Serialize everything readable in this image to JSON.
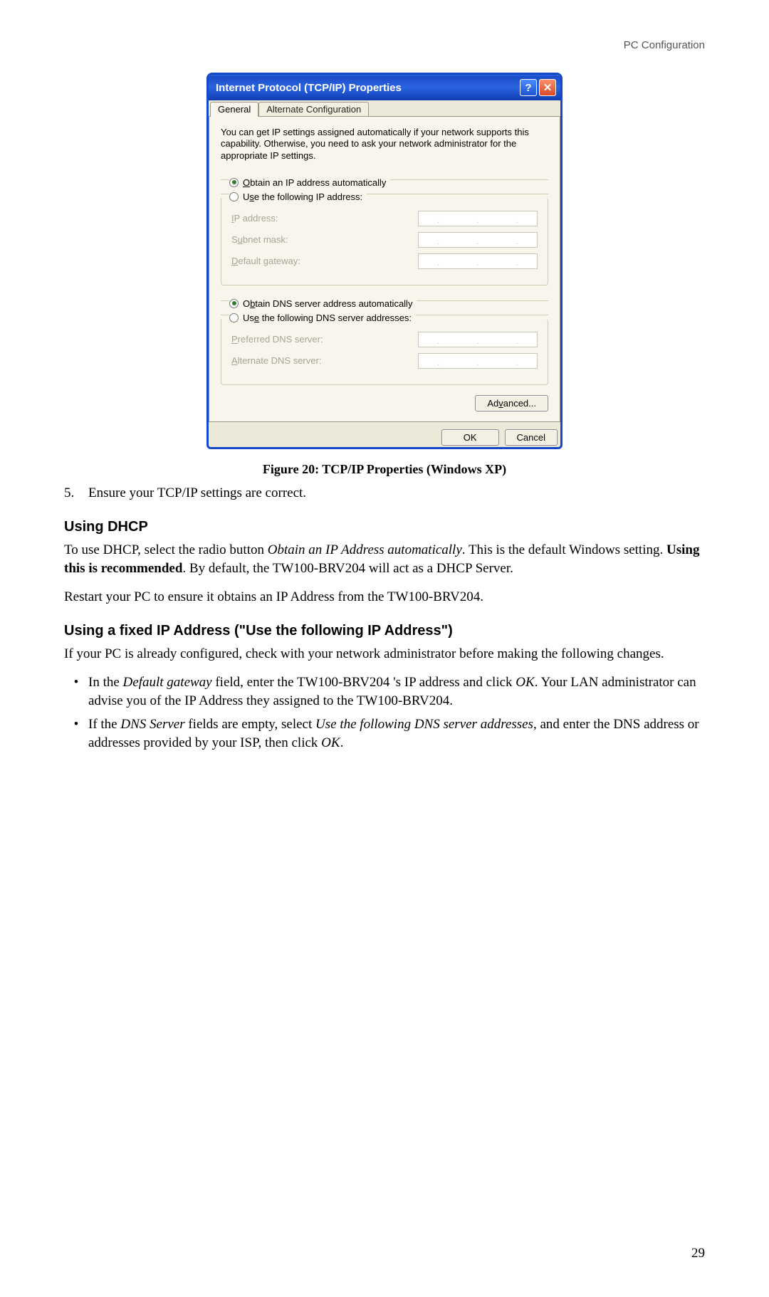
{
  "header": "PC Configuration",
  "page_number": "29",
  "dialog": {
    "title": "Internet Protocol (TCP/IP) Properties",
    "tabs": [
      "General",
      "Alternate Configuration"
    ],
    "description": "You can get IP settings assigned automatically if your network supports this capability. Otherwise, you need to ask your network administrator for the appropriate IP settings.",
    "radio_obtain_ip": "Obtain an IP address automatically",
    "radio_use_ip": "Use the following IP address:",
    "fields_ip": {
      "ip_address": "IP address:",
      "subnet_mask": "Subnet mask:",
      "default_gateway": "Default gateway:"
    },
    "radio_obtain_dns": "Obtain DNS server address automatically",
    "radio_use_dns": "Use the following DNS server addresses:",
    "fields_dns": {
      "preferred": "Preferred DNS server:",
      "alternate": "Alternate DNS server:"
    },
    "advanced_btn": "Advanced...",
    "ok_btn": "OK",
    "cancel_btn": "Cancel"
  },
  "caption": "Figure 20: TCP/IP Properties (Windows XP)",
  "step5_num": "5.",
  "step5_text": "Ensure your TCP/IP settings are correct.",
  "h_dhcp": "Using DHCP",
  "p_dhcp_1_a": "To use DHCP, select the radio button ",
  "p_dhcp_1_b": "Obtain an IP Address automatically",
  "p_dhcp_1_c": ". This is the default Windows setting. ",
  "p_dhcp_1_d": "Using this is recommended",
  "p_dhcp_1_e": ". By default, the TW100-BRV204 will act as a DHCP Server.",
  "p_dhcp_2": "Restart your PC to ensure it obtains an IP Address from the TW100-BRV204.",
  "h_fixed": "Using a fixed IP Address (\"Use the following IP Address\")",
  "p_fixed_intro": "If your PC is already configured, check with your network administrator before making the following changes.",
  "bullet1_a": "In the ",
  "bullet1_b": "Default gateway",
  "bullet1_c": " field, enter the TW100-BRV204 's IP address and click ",
  "bullet1_d": "OK",
  "bullet1_e": ". Your LAN administrator can advise you of the IP Address they assigned to the TW100-BRV204.",
  "bullet2_a": "If the ",
  "bullet2_b": "DNS Server",
  "bullet2_c": " fields are empty, select ",
  "bullet2_d": "Use the following DNS server addresses",
  "bullet2_e": ", and enter the DNS address or addresses provided by your ISP, then click ",
  "bullet2_f": "OK",
  "bullet2_g": "."
}
